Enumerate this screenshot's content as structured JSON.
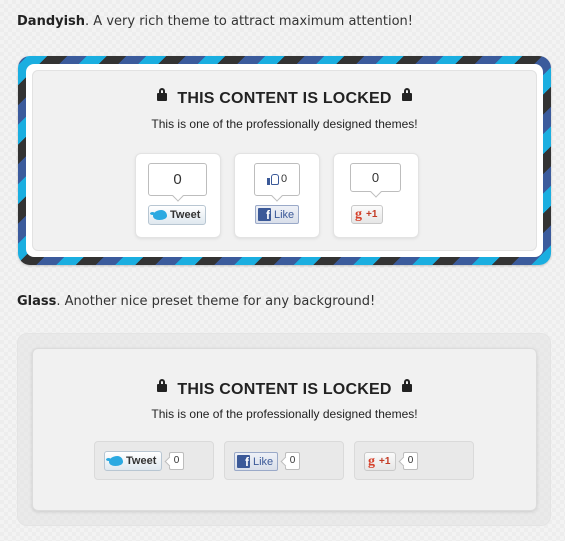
{
  "dandyish": {
    "caption_name": "Dandyish",
    "caption_text": ". A very rich theme to attract maximum attention!",
    "title": "THIS CONTENT IS LOCKED",
    "message": "This is one of the professionally designed themes!",
    "twitter": {
      "count": "0",
      "label": "Tweet"
    },
    "facebook": {
      "count": "0",
      "label": "Like"
    },
    "google": {
      "count": "0",
      "label": "+1"
    },
    "stripe_colors": [
      "#1aaee0",
      "#3b5b9c",
      "#333333"
    ]
  },
  "glass": {
    "caption_name": "Glass",
    "caption_text": ". Another nice preset theme for any background!",
    "title": "THIS CONTENT IS LOCKED",
    "message": "This is one of the professionally designed themes!",
    "twitter": {
      "count": "0",
      "label": "Tweet"
    },
    "facebook": {
      "count": "0",
      "label": "Like"
    },
    "google": {
      "count": "0",
      "label": "+1"
    }
  },
  "icons": {
    "lock": "lock-icon",
    "twitter": "twitter-bird-icon",
    "facebook": "facebook-f-icon",
    "facebook_like": "thumbs-up-icon",
    "google": "google-g-icon"
  }
}
